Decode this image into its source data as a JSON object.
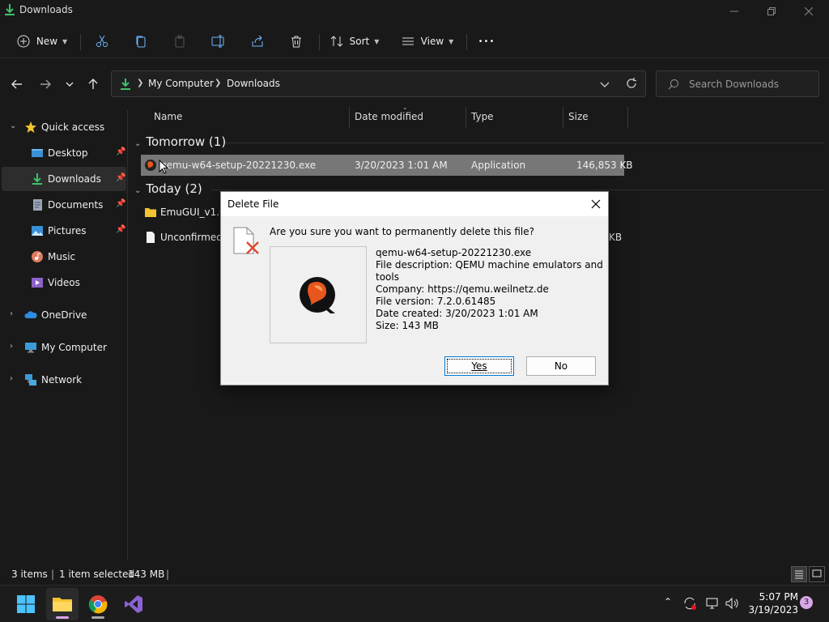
{
  "window": {
    "title": "Downloads",
    "controls": [
      "minimize-icon",
      "maximize-icon",
      "close-icon"
    ]
  },
  "toolbar": {
    "new_label": "New",
    "sort_label": "Sort",
    "view_label": "View",
    "more_label": "•••",
    "icons": [
      "cut-icon",
      "copy-icon",
      "paste-icon",
      "rename-icon",
      "share-icon",
      "delete-icon"
    ]
  },
  "nav": {
    "breadcrumb": [
      "My Computer",
      "Downloads"
    ],
    "search_placeholder": "Search Downloads"
  },
  "sidebar": {
    "items": [
      {
        "label": "Quick access",
        "icon": "star-icon",
        "pinned": false
      },
      {
        "label": "Desktop",
        "icon": "desktop-icon",
        "pinned": true
      },
      {
        "label": "Downloads",
        "icon": "download-icon",
        "pinned": true,
        "selected": true
      },
      {
        "label": "Documents",
        "icon": "documents-icon",
        "pinned": true
      },
      {
        "label": "Pictures",
        "icon": "pictures-icon",
        "pinned": true
      },
      {
        "label": "Music",
        "icon": "music-icon",
        "pinned": false
      },
      {
        "label": "Videos",
        "icon": "videos-icon",
        "pinned": false
      },
      {
        "label": "OneDrive",
        "icon": "cloud-icon",
        "pinned": false
      },
      {
        "label": "My Computer",
        "icon": "computer-icon",
        "pinned": false
      },
      {
        "label": "Network",
        "icon": "network-icon",
        "pinned": false
      }
    ]
  },
  "files": {
    "columns": [
      "Name",
      "Date modified",
      "Type",
      "Size"
    ],
    "groups": [
      {
        "label": "Tomorrow (1)",
        "rows": [
          {
            "name": "qemu-w64-setup-20221230.exe",
            "date": "3/20/2023 1:01 AM",
            "type": "Application",
            "size": "146,853 KB",
            "selected": true
          }
        ]
      },
      {
        "label": "Today (2)",
        "rows": [
          {
            "name": "EmuGUI_v1.0.",
            "date": "",
            "type": "",
            "size": ""
          },
          {
            "name": "Unconfirmed",
            "date": "",
            "type": "",
            "size": "KB"
          }
        ]
      }
    ]
  },
  "status": {
    "items_count": "3 items",
    "selection": "1 item selected",
    "selection_size": "143 MB"
  },
  "dialog": {
    "title": "Delete File",
    "question": "Are you sure you want to permanently delete this file?",
    "file_name": "qemu-w64-setup-20221230.exe",
    "description": "File description: QEMU machine emulators and tools",
    "company": "Company: https://qemu.weilnetz.de",
    "version": "File version: 7.2.0.61485",
    "created": "Date created: 3/20/2023 1:01 AM",
    "size": "Size: 143 MB",
    "yes_label": "Yes",
    "no_label": "No"
  },
  "taskbar": {
    "apps": [
      "windows-start-icon",
      "file-explorer-icon",
      "chrome-icon",
      "visual-studio-icon"
    ],
    "time": "5:07 PM",
    "date": "3/19/2023",
    "notification_count": "3"
  },
  "colors": {
    "background": "#191919",
    "selection": "#777777",
    "dialog_bg": "#f0f0f0",
    "accent": "#0078d7",
    "download_green": "#3ec26b",
    "folder_yellow": "#f4c430"
  }
}
